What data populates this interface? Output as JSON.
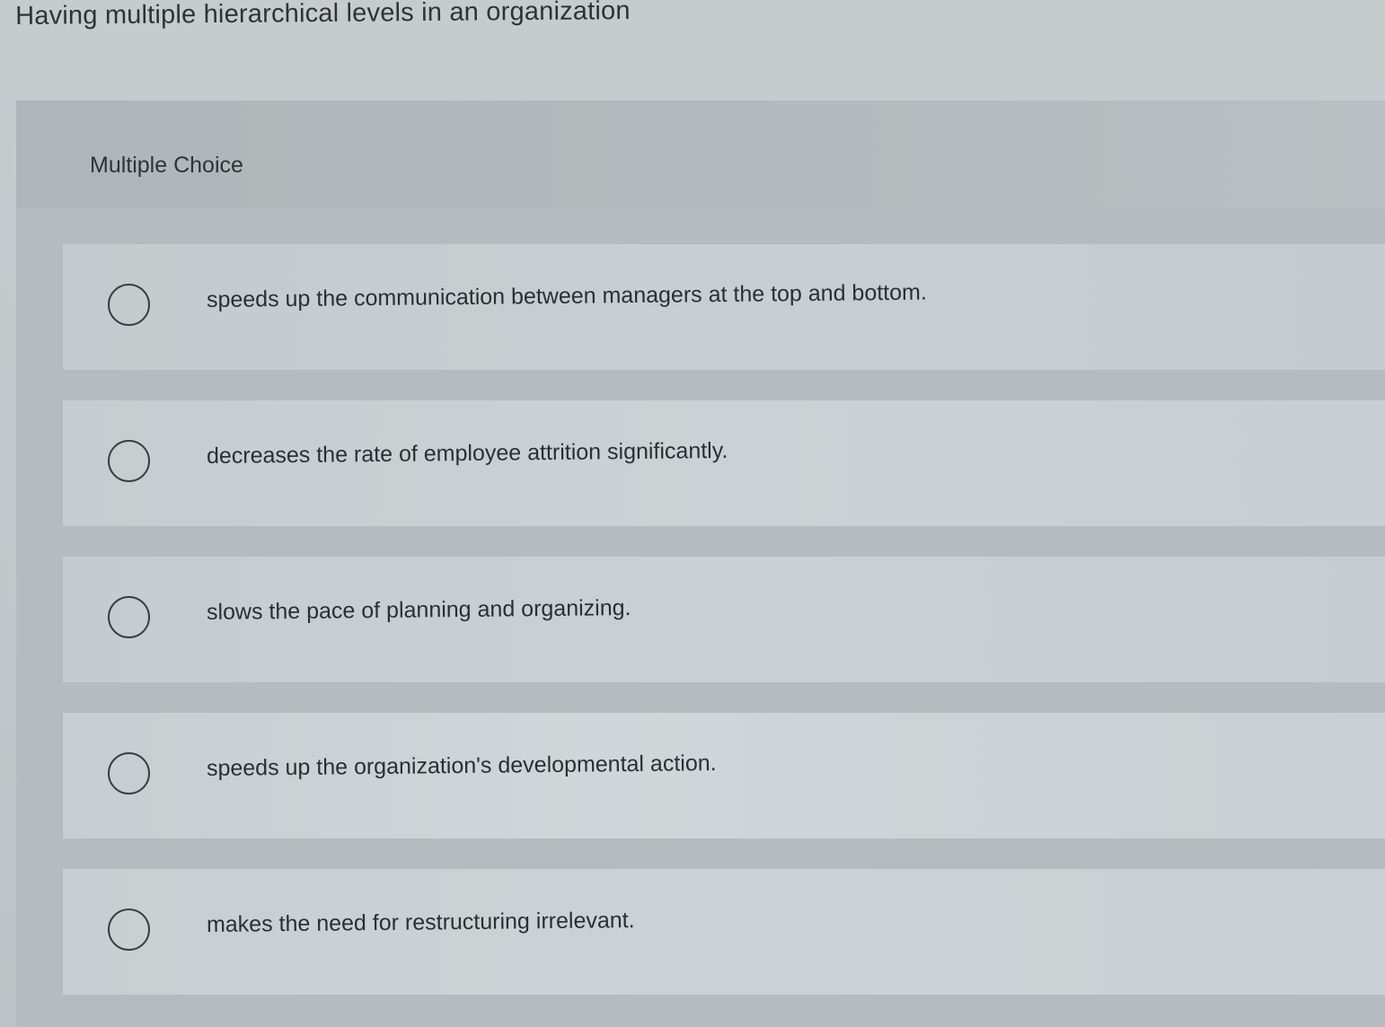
{
  "question": {
    "title": "Having multiple hierarchical levels in an organization"
  },
  "panel": {
    "label": "Multiple Choice"
  },
  "options": [
    {
      "text": "speeds up the communication between managers at the top and bottom.",
      "selected": false
    },
    {
      "text": "decreases the rate of employee attrition significantly.",
      "selected": false
    },
    {
      "text": "slows the pace of planning and organizing.",
      "selected": false
    },
    {
      "text": "speeds up the organization's developmental action.",
      "selected": false
    },
    {
      "text": "makes the need for restructuring irrelevant.",
      "selected": false
    }
  ],
  "icons": {
    "radio": "radio-unselected-icon"
  }
}
